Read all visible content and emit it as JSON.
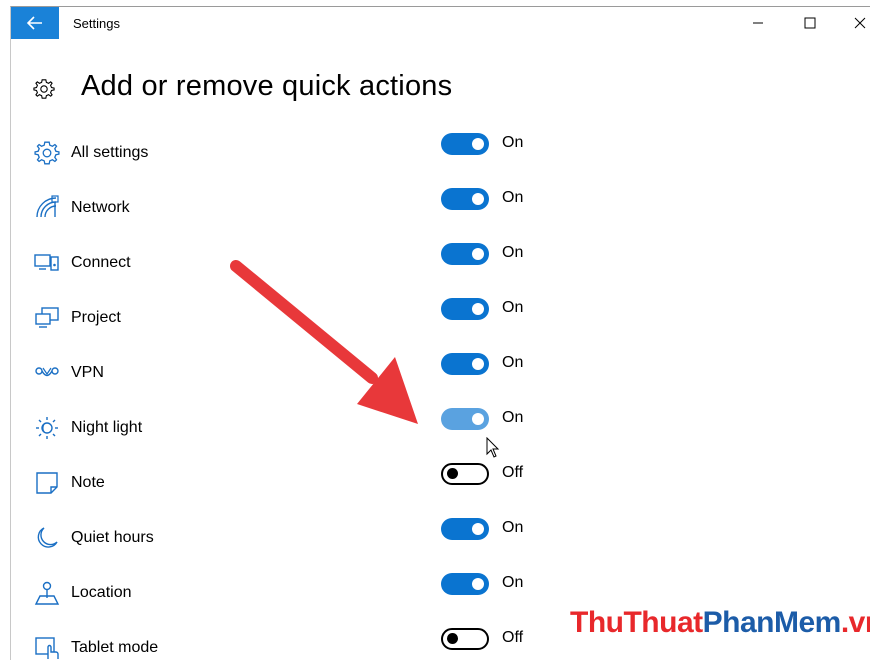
{
  "window": {
    "title": "Settings",
    "controls": {
      "minimize": "–",
      "maximize": "□",
      "close": "✕"
    }
  },
  "header": {
    "title": "Add or remove quick actions",
    "icon": "gear-icon"
  },
  "actions": [
    {
      "label": "All settings",
      "state": "On",
      "on": true,
      "icon": "gear-icon"
    },
    {
      "label": "Network",
      "state": "On",
      "on": true,
      "icon": "network-icon"
    },
    {
      "label": "Connect",
      "state": "On",
      "on": true,
      "icon": "connect-icon"
    },
    {
      "label": "Project",
      "state": "On",
      "on": true,
      "icon": "project-icon"
    },
    {
      "label": "VPN",
      "state": "On",
      "on": true,
      "icon": "vpn-icon"
    },
    {
      "label": "Night light",
      "state": "On",
      "on": true,
      "icon": "night-light-icon",
      "hovered": true
    },
    {
      "label": "Note",
      "state": "Off",
      "on": false,
      "icon": "note-icon"
    },
    {
      "label": "Quiet hours",
      "state": "On",
      "on": true,
      "icon": "moon-icon"
    },
    {
      "label": "Location",
      "state": "On",
      "on": true,
      "icon": "location-icon"
    },
    {
      "label": "Tablet mode",
      "state": "Off",
      "on": false,
      "icon": "tablet-mode-icon"
    }
  ],
  "colors": {
    "accent": "#0a74d0",
    "hover": "#5aa2e0",
    "annotation_arrow": "#e8383a"
  },
  "watermark": {
    "part1": "ThuThuat",
    "part2": "PhanMem",
    "part3": ".vn"
  }
}
